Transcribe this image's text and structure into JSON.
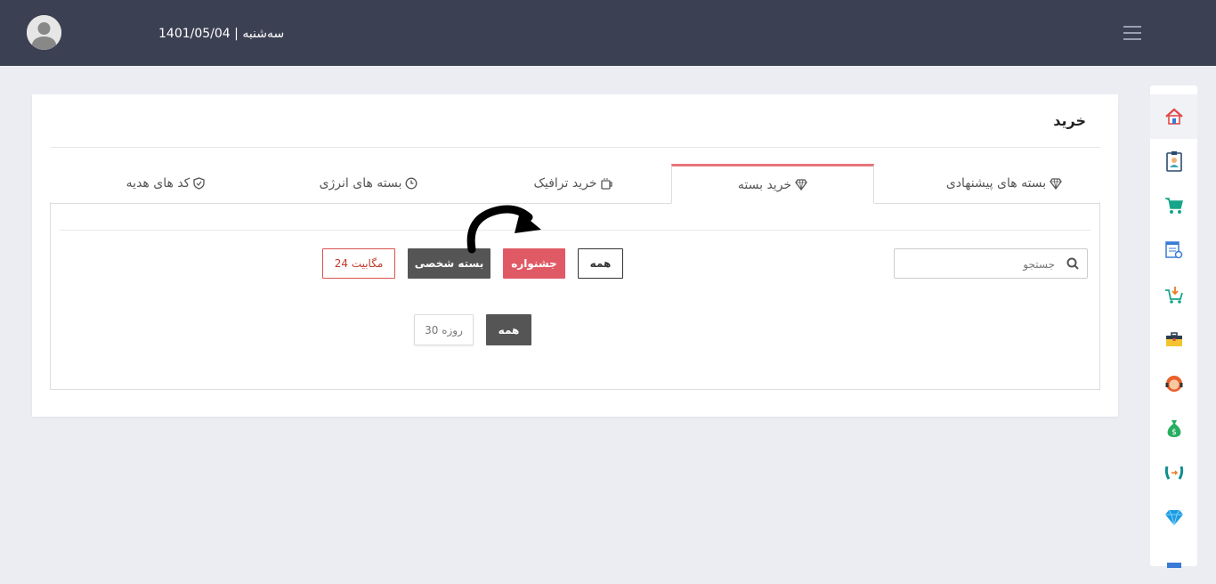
{
  "header": {
    "date_text": "1401/05/04 | سه‌شنبه",
    "bg_color": "#3c4053"
  },
  "page": {
    "title": "خرید"
  },
  "tabs": [
    {
      "label": "بسته های پیشنهادی",
      "icon": "diamond-icon"
    },
    {
      "label": "خرید بسته",
      "icon": "diamond-icon",
      "active": true
    },
    {
      "label": "خرید ترافیک",
      "icon": "mug-icon"
    },
    {
      "label": "بسته های انرژی",
      "icon": "clock-icon"
    },
    {
      "label": "کد های هدیه",
      "icon": "shield-icon"
    }
  ],
  "search": {
    "placeholder": "جستجو"
  },
  "filters": {
    "all": "همه",
    "festival": "جشنواره",
    "personal": "بسته شخصی",
    "size_24mb": "24 مگابیت"
  },
  "duration_filters": {
    "all": "همه",
    "days_30": "30 روزه"
  },
  "sidebar_icons": [
    "home-icon",
    "profile-card-icon",
    "cart-icon",
    "list-search-icon",
    "cart-download-icon",
    "toolbox-icon",
    "support-agent-icon",
    "money-bag-icon",
    "phone-transfer-icon",
    "gem-icon"
  ],
  "colors": {
    "accent_red": "#e05a66",
    "dark_button": "#555555",
    "active_tab_border": "#e8747c"
  }
}
